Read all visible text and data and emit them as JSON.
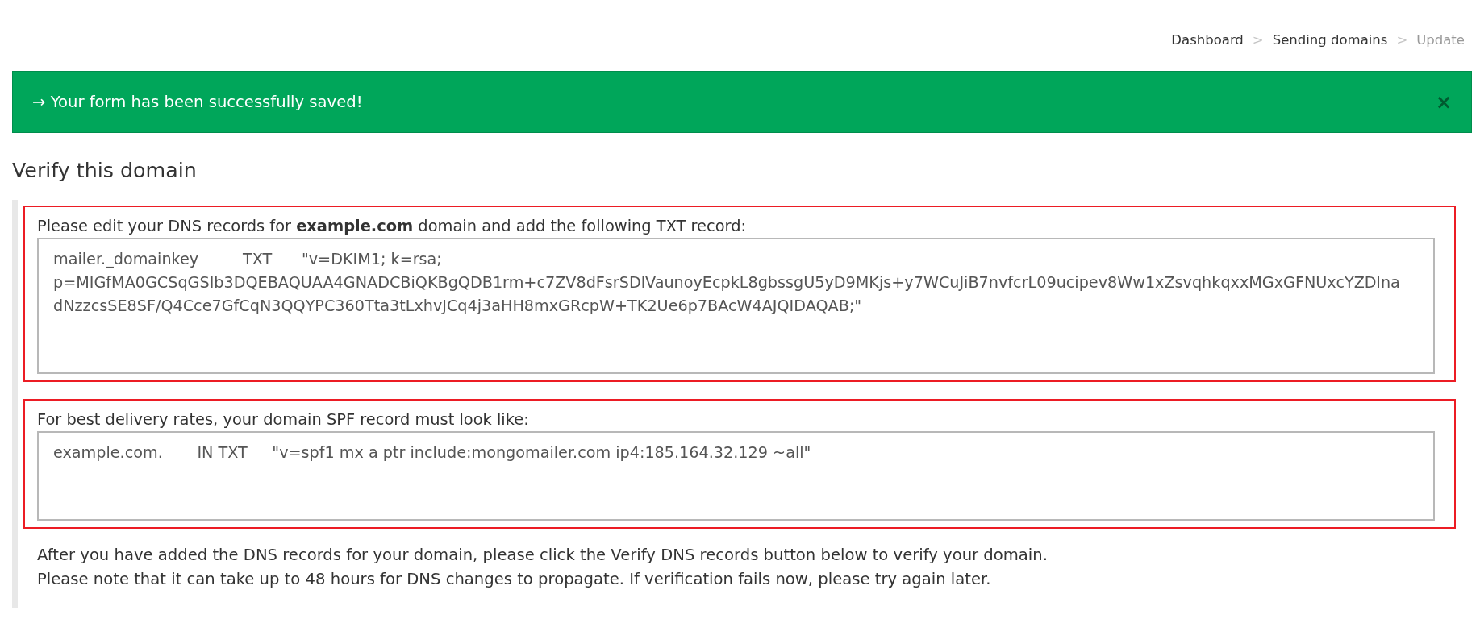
{
  "breadcrumb": {
    "items": [
      {
        "label": "Dashboard",
        "current": false,
        "separator": ">"
      },
      {
        "label": "Sending domains",
        "current": false,
        "separator": ">"
      },
      {
        "label": "Update",
        "current": true
      }
    ]
  },
  "alert": {
    "kind": "success",
    "message": "→ Your form has been successfully saved!",
    "close": "×"
  },
  "verification": {
    "title": "Verify this domain",
    "records": [
      {
        "label": "Please edit your DNS records for **example.com** domain and add the following TXT record:",
        "value": "mailer._domainkey         TXT      \"v=DKIM1; k=rsa;\np=MIGfMA0GCSqGSIb3DQEBAQUAA4GNADCBiQKBgQDB1rm+c7ZV8dFsrSDlVaunoyEcpkL8gbssgU5yD9MKjs+y7WCuJiB7nvfcrL09ucipev8Ww1xZsvqhkqxxMGxGFNUxcYZDlna\ndNzzcsSE8SF/Q4Cce7GfCqN3QQYPC360Tta3tLxhvJCq4j3aHH8mxGRcpW+TK2Ue6p7BAcW4AJQIDAQAB;\"",
        "highlighted": true
      },
      {
        "label": "For best delivery rates, your domain SPF record must look like:",
        "value": "example.com.       IN TXT     \"v=spf1 mx a ptr include:mongomailer.com ip4:185.164.32.129 ~all\"",
        "highlighted": true
      }
    ],
    "notes": [
      "After you have added the DNS records for your domain, please click the Verify DNS records button below to verify your domain.",
      "Please note that it can take up to 48 hours for DNS changes to propagate. If verification fails now, please try again later."
    ]
  }
}
